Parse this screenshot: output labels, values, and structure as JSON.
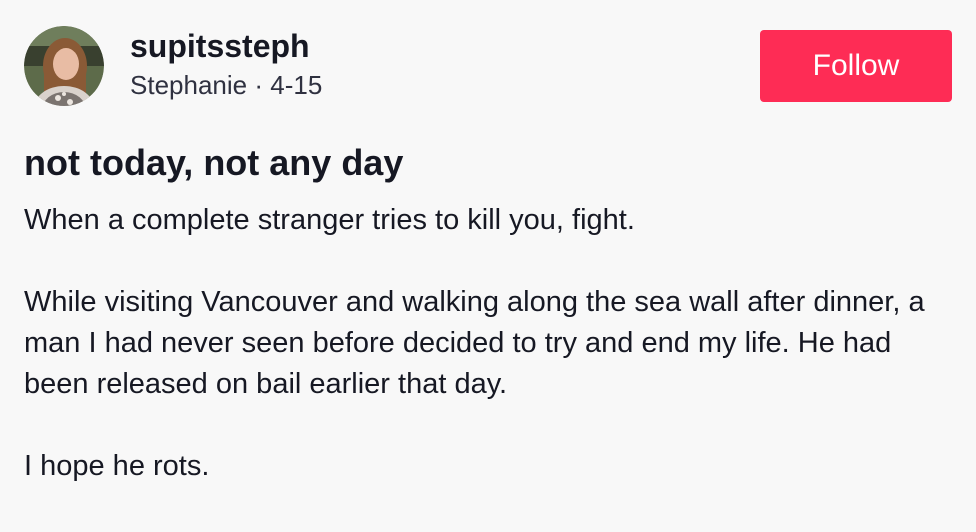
{
  "post": {
    "username": "supitssteph",
    "display_name": "Stephanie",
    "separator": "·",
    "date": "4-15",
    "follow_label": "Follow",
    "title": "not today, not any day",
    "paragraphs": [
      "When a complete stranger tries to kill you, fight.",
      "While visiting Vancouver and walking along the sea wall after dinner, a man I had never seen before decided to try and end my life. He had been released on bail earlier that day.",
      "I hope he rots."
    ]
  },
  "colors": {
    "background": "#f8f8f8",
    "follow_button": "#fe2c55",
    "text": "#161823"
  }
}
